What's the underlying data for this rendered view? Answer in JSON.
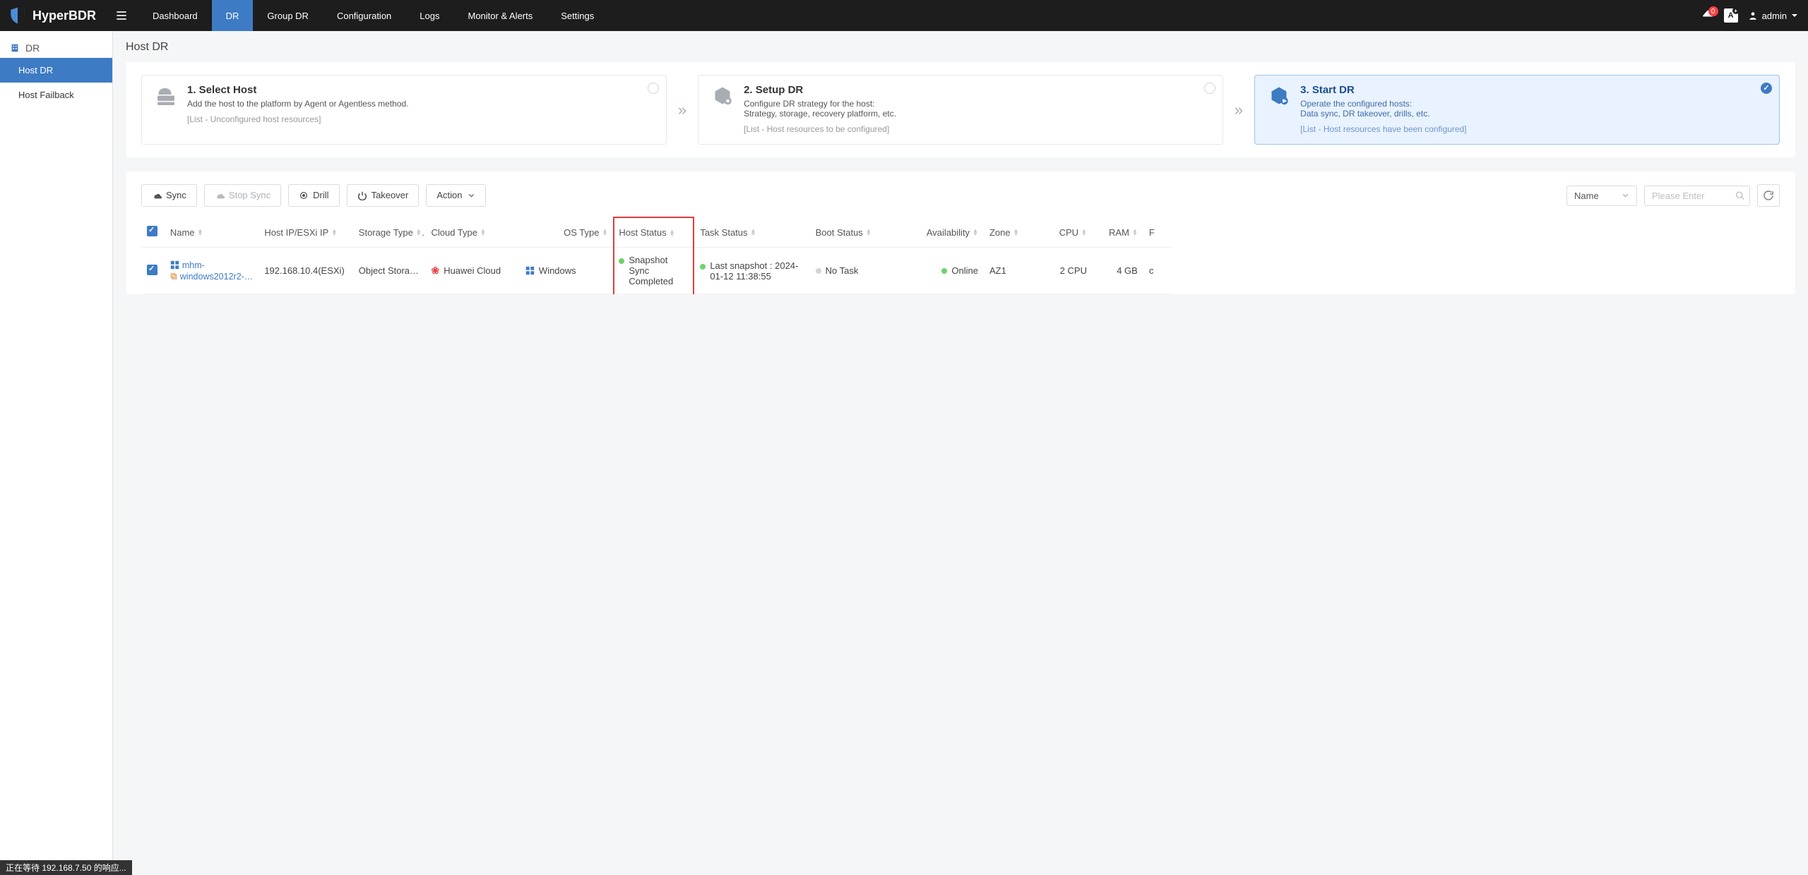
{
  "brand": "HyperBDR",
  "nav": [
    "Dashboard",
    "DR",
    "Group DR",
    "Configuration",
    "Logs",
    "Monitor & Alerts",
    "Settings"
  ],
  "nav_active_index": 1,
  "notif_count": "0",
  "user_label": "admin",
  "sidebar": {
    "header": "DR",
    "items": [
      "Host DR",
      "Host Failback"
    ],
    "active_index": 0
  },
  "page_title": "Host DR",
  "steps": [
    {
      "title": "1. Select Host",
      "desc": "Add the host to the platform by Agent or Agentless method.",
      "desc2": "",
      "sub": "[List - Unconfigured host resources]",
      "mark": "empty"
    },
    {
      "title": "2. Setup DR",
      "desc": "Configure DR strategy for the host:",
      "desc2": "Strategy, storage, recovery platform, etc.",
      "sub": "[List - Host resources to be configured]",
      "mark": "empty"
    },
    {
      "title": "3. Start DR",
      "desc": "Operate the configured hosts:",
      "desc2": "Data sync, DR takeover, drills, etc.",
      "sub": "[List - Host resources have been configured]",
      "mark": "done"
    }
  ],
  "buttons": {
    "sync": "Sync",
    "stop": "Stop Sync",
    "drill": "Drill",
    "takeover": "Takeover",
    "action": "Action"
  },
  "filter": {
    "field": "Name",
    "placeholder": "Please Enter"
  },
  "columns": [
    "Name",
    "Host IP/ESXi IP",
    "Storage Type",
    "Cloud Type",
    "OS Type",
    "Host Status",
    "Task Status",
    "Boot Status",
    "Availability",
    "Zone",
    "CPU",
    "RAM",
    "F"
  ],
  "row": {
    "name_top": "mhm-",
    "name_bottom": "windows2012r2-…",
    "ip": "192.168.10.4(ESXi)",
    "storage": "Object Storage",
    "cloud": "Huawei Cloud",
    "os": "Windows",
    "host_status": "Snapshot Sync Completed",
    "task_status": "Last snapshot : 2024-01-12 11:38:55",
    "boot_status": "No Task",
    "availability": "Online",
    "zone": "AZ1",
    "cpu": "2 CPU",
    "ram": "4 GB",
    "extra": "c"
  },
  "status_bar": "正在等待 192.168.7.50 的响应..."
}
